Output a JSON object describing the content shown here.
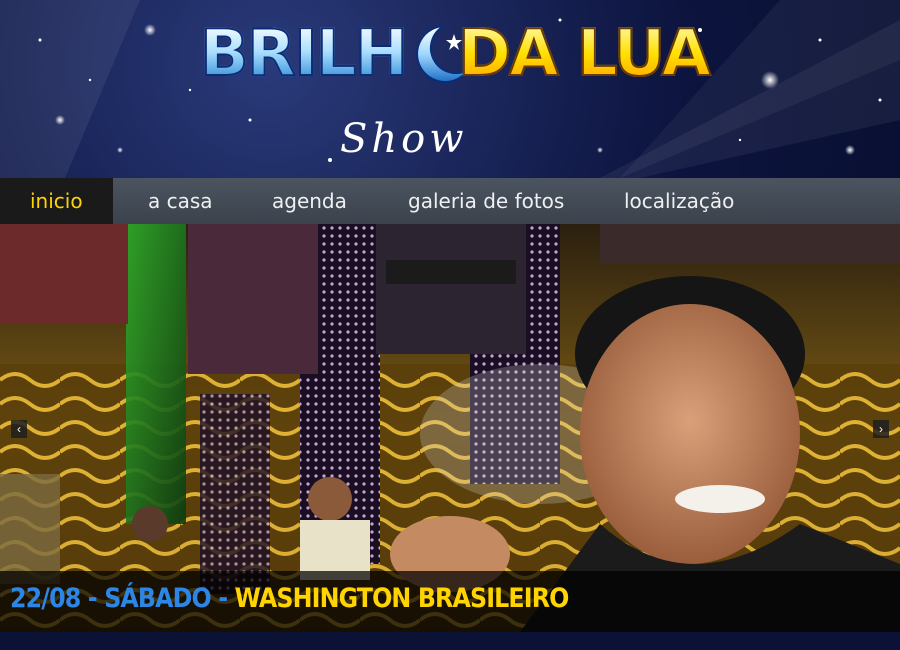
{
  "logo": {
    "word1": "BRILH",
    "word2": "DA LUA",
    "word3": "Show"
  },
  "nav": {
    "items": [
      {
        "label": "inicio",
        "active": true
      },
      {
        "label": "a casa",
        "active": false
      },
      {
        "label": "agenda",
        "active": false
      },
      {
        "label": "galeria de fotos",
        "active": false
      },
      {
        "label": "localização",
        "active": false
      }
    ]
  },
  "slider": {
    "prev_icon": "chevron-left-icon",
    "next_icon": "chevron-right-icon",
    "prev_label": "‹",
    "next_label": "›",
    "caption": {
      "date": "22/08",
      "sep1": " - ",
      "day": "SÁBADO",
      "sep2": " - ",
      "artist": "WASHINGTON BRASILEIRO"
    }
  },
  "colors": {
    "nav_active_text": "#ffd400",
    "caption_blue": "#2b86e6",
    "caption_yellow": "#ffd400"
  }
}
